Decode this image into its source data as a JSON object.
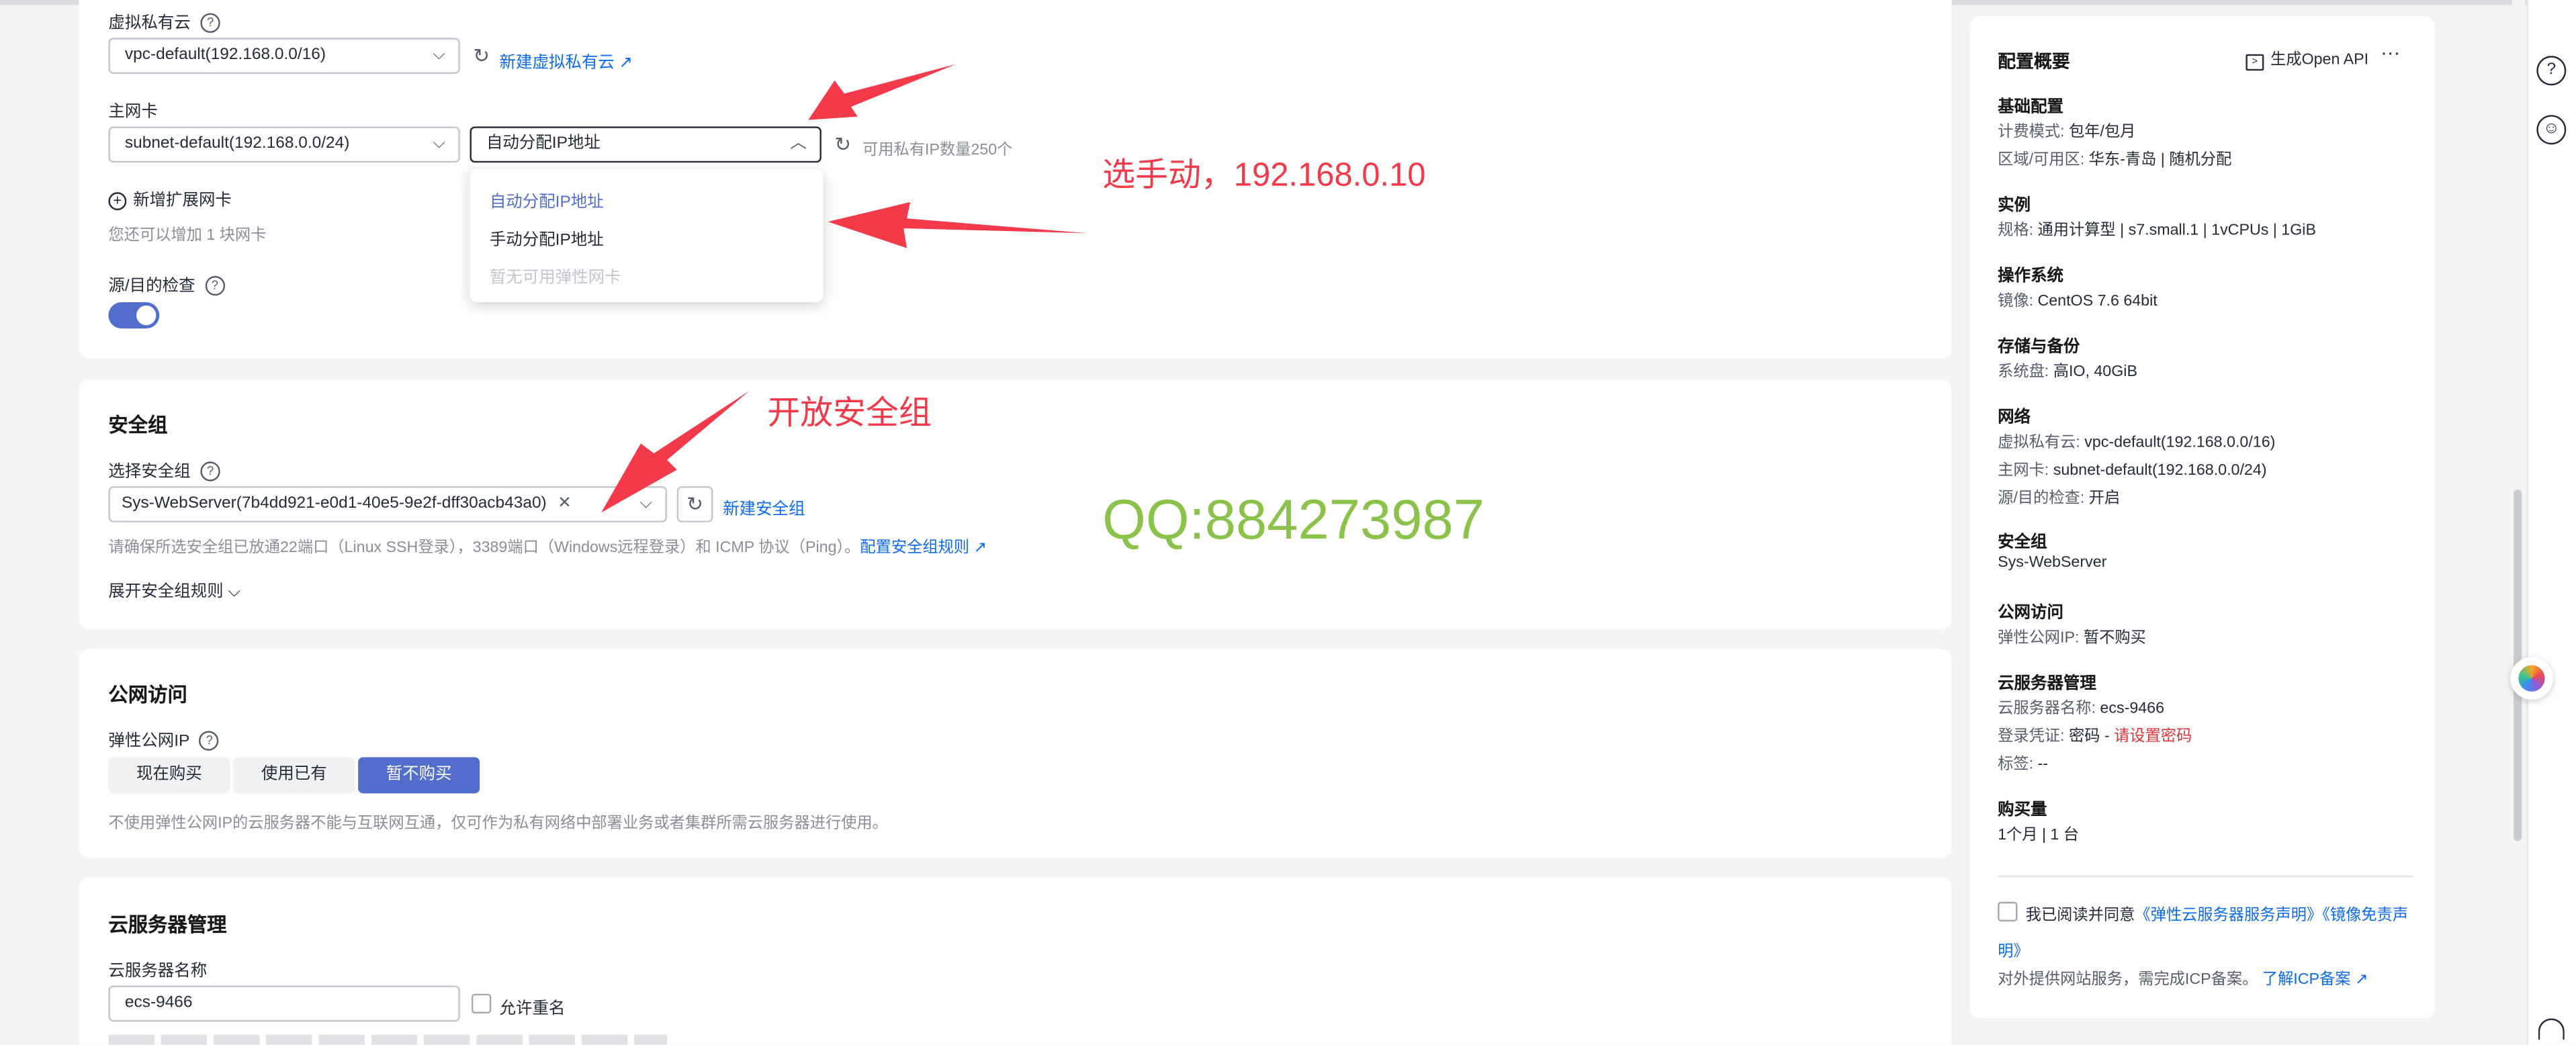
{
  "network": {
    "vpc_label": "虚拟私有云",
    "vpc_value": "vpc-default(192.168.0.0/16)",
    "vpc_new_link": "新建虚拟私有云",
    "nic_label": "主网卡",
    "subnet_value": "subnet-default(192.168.0.0/24)",
    "ip_mode_value": "自动分配IP地址",
    "ip_count_text": "可用私有IP数量250个",
    "dropdown_options": [
      "自动分配IP地址",
      "手动分配IP地址",
      "暂无可用弹性网卡"
    ],
    "add_nic_label": "新增扩展网卡",
    "add_nic_hint": "您还可以增加 1 块网卡",
    "src_dst_label": "源/目的检查"
  },
  "security": {
    "title": "安全组",
    "select_label": "选择安全组",
    "selected_tag": "Sys-WebServer(7b4dd921-e0d1-40e5-9e2f-dff30acb43a0)",
    "new_link": "新建安全组",
    "hint": "请确保所选安全组已放通22端口（Linux SSH登录），3389端口（Windows远程登录）和 ICMP 协议（Ping）。",
    "hint_link": "配置安全组规则",
    "expand": "展开安全组规则"
  },
  "public": {
    "title": "公网访问",
    "eip_label": "弹性公网IP",
    "options": [
      "现在购买",
      "使用已有",
      "暂不购买"
    ],
    "hint": "不使用弹性公网IP的云服务器不能与互联网互通，仅可作为私有网络中部署业务或者集群所需云服务器进行使用。"
  },
  "server": {
    "title": "云服务器管理",
    "name_label": "云服务器名称",
    "name_value": "ecs-9466",
    "allow_dup": "允许重名"
  },
  "annotations": {
    "manual_note": "选手动，192.168.0.10",
    "sg_note": "开放安全组",
    "qq": "QQ:884273987"
  },
  "summary": {
    "title": "配置概要",
    "open_api": "生成Open API",
    "basic": {
      "heading": "基础配置",
      "billing_k": "计费模式: ",
      "billing_v": "包年/包月",
      "region_k": "区域/可用区: ",
      "region_v": "华东-青岛 | 随机分配"
    },
    "instance": {
      "heading": "实例",
      "spec_k": "规格: ",
      "spec_v": "通用计算型 | s7.small.1 | 1vCPUs | 1GiB"
    },
    "os": {
      "heading": "操作系统",
      "image_k": "镜像: ",
      "image_v": "CentOS 7.6 64bit"
    },
    "storage": {
      "heading": "存储与备份",
      "disk_k": "系统盘: ",
      "disk_v": "高IO, 40GiB"
    },
    "net": {
      "heading": "网络",
      "vpc_k": "虚拟私有云: ",
      "vpc_v": "vpc-default(192.168.0.0/16)",
      "nic_k": "主网卡: ",
      "nic_v": "subnet-default(192.168.0.0/24)",
      "check_k": "源/目的检查: ",
      "check_v": "开启"
    },
    "sg": {
      "heading": "安全组",
      "value": "Sys-WebServer"
    },
    "pub": {
      "heading": "公网访问",
      "eip_k": "弹性公网IP: ",
      "eip_v": "暂不购买"
    },
    "mgmt": {
      "heading": "云服务器管理",
      "name_k": "云服务器名称: ",
      "name_v": "ecs-9466",
      "cred_k": "登录凭证: ",
      "cred_v": "密码 - ",
      "cred_link": "请设置密码",
      "tag_k": "标签: ",
      "tag_v": "--"
    },
    "qty": {
      "heading": "购买量",
      "value": "1个月 | 1 台"
    },
    "agree_prefix": "我已阅读并同意",
    "agree_link1": "《弹性云服务器服务声明》",
    "agree_link2a": "《镜像免责声",
    "agree_link2b": "明》",
    "icp_text": "对外提供网站服务，需完成ICP备案。",
    "icp_link": "了解ICP备案"
  },
  "colors": {
    "primary": "#0d6bf2",
    "toggle": "#526ecc",
    "annotation": "#f23a4b",
    "watermark": "#8bc34a",
    "danger": "#e0343c"
  }
}
